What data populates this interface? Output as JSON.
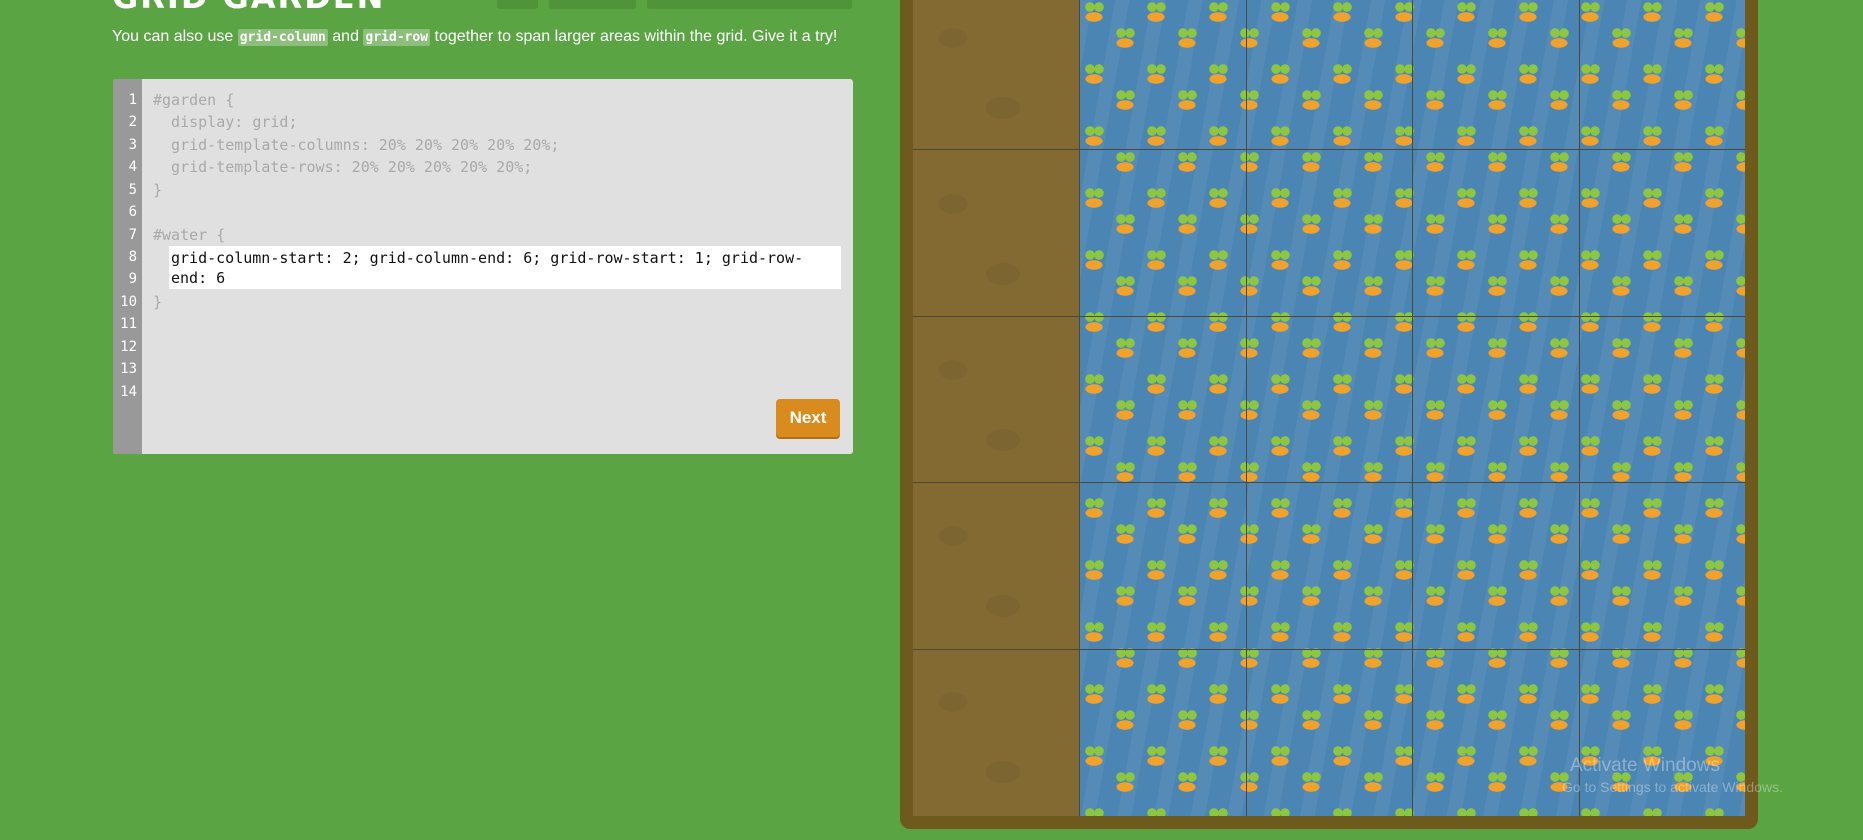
{
  "header": {
    "title": "GRID GARDEN"
  },
  "instruction": {
    "before": "You can also use ",
    "code1": "grid-column",
    "middle": " and ",
    "code2": "grid-row",
    "after": " together to span larger areas within the grid. Give it a try!"
  },
  "editor": {
    "line_numbers": [
      "1",
      "2",
      "3",
      "4",
      "5",
      "6",
      "7",
      "8",
      "9",
      "10",
      "11",
      "12",
      "13",
      "14"
    ],
    "lines": [
      "#garden {",
      "  display: grid;",
      "  grid-template-columns: 20% 20% 20% 20% 20%;",
      "  grid-template-rows: 20% 20% 20% 20% 20%;",
      "}",
      "",
      "#water {",
      "}"
    ],
    "answer_value": "grid-column-start: 2; grid-column-end: 6; grid-row-start: 1; grid-row-end: 6",
    "next_label": "Next"
  },
  "garden": {
    "columns": 5,
    "rows": 5,
    "water_column_span": "2 / 6",
    "water_row_span": "1 / 6",
    "colors": {
      "background": "#5ba444",
      "frame": "#6e5a1c",
      "soil": "#836a33",
      "water": "#4a85b3",
      "carrot": "#f1a22a",
      "leaf": "#8dc63f"
    }
  },
  "watermark": {
    "title": "Activate Windows",
    "subtitle": "Go to Settings to activate Windows."
  }
}
